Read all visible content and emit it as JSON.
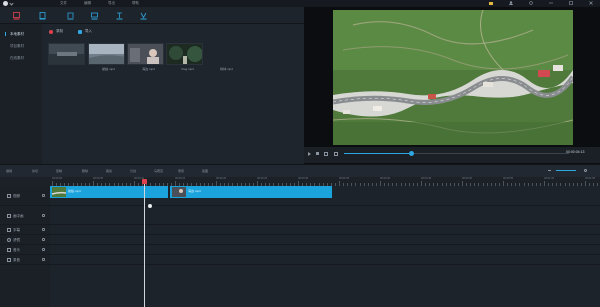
{
  "titlebar": {
    "menus": [
      "文件",
      "编辑",
      "导出",
      "帮助"
    ]
  },
  "toolbar": {
    "tools": [
      {
        "name": "media-icon",
        "active": true
      },
      {
        "name": "text-icon"
      },
      {
        "name": "music-icon"
      },
      {
        "name": "transition-icon"
      },
      {
        "name": "filter-icon"
      },
      {
        "name": "element-icon"
      }
    ]
  },
  "sidebar": {
    "items": [
      {
        "label": "本地素材",
        "active": true
      },
      {
        "label": "项目素材"
      },
      {
        "label": "在线素材"
      }
    ]
  },
  "library": {
    "record_label": "录制",
    "import_label": "导入",
    "media": [
      {
        "label": "航拍.mp4"
      },
      {
        "label": "海边.mp4"
      },
      {
        "label": "Vlog.mp4"
      },
      {
        "label": "树林.mp4"
      }
    ]
  },
  "preview": {
    "timecode": "00:00:04:13",
    "progress_fraction": 0.3
  },
  "edit_toolbar": {
    "items": [
      "撤销",
      "剪切",
      "复制",
      "删除",
      "裁剪",
      "分割",
      "马赛克",
      "录音",
      "截图"
    ]
  },
  "timeline": {
    "ruler_ticks": [
      "00:00:00",
      "00:00:05",
      "00:00:10",
      "00:00:15",
      "00:00:20",
      "00:00:25",
      "00:00:30",
      "00:00:35",
      "00:00:40",
      "00:00:45",
      "00:00:50",
      "00:00:55",
      "00:01:00",
      "00:01:05"
    ],
    "tracks": [
      {
        "label": "视频",
        "icon": "video-track-icon"
      },
      {
        "label": "画中画",
        "icon": "pip-track-icon"
      },
      {
        "label": "字幕",
        "icon": "text-track-icon"
      },
      {
        "label": "滤镜",
        "icon": "filter-track-icon"
      },
      {
        "label": "音乐",
        "icon": "music-track-icon"
      },
      {
        "label": "录音",
        "icon": "voice-track-icon"
      }
    ],
    "clips": [
      {
        "label": "航拍.mp4"
      },
      {
        "label": "海边.mp4"
      }
    ]
  },
  "colors": {
    "accent": "#1aa3dc",
    "playhead": "#e0424d",
    "background": "#1a1f27"
  }
}
